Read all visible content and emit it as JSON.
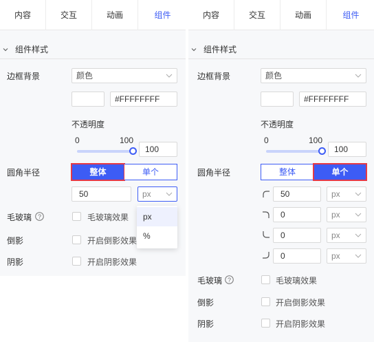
{
  "tabs": [
    "内容",
    "交互",
    "动画",
    "组件"
  ],
  "section_title": "组件样式",
  "border_bg": {
    "label": "边框背景",
    "fill_type": "颜色",
    "color_hex": "#FFFFFFFF",
    "swatch_color": "#ffffff",
    "opacity_label": "不透明度",
    "slider_min": "0",
    "slider_max": "100",
    "opacity_value": "100",
    "opacity_fraction": 1.0
  },
  "radius": {
    "label": "圆角半径",
    "modes": [
      "整体",
      "单个"
    ],
    "overall_value": "50",
    "unit": "px",
    "unit_options": [
      "px",
      "%"
    ],
    "individual": [
      {
        "value": "50",
        "unit": "px"
      },
      {
        "value": "0",
        "unit": "px"
      },
      {
        "value": "0",
        "unit": "px"
      },
      {
        "value": "0",
        "unit": "px"
      }
    ]
  },
  "frosted": {
    "label": "毛玻璃",
    "checkbox_label": "毛玻璃效果"
  },
  "reflection": {
    "label": "倒影",
    "checkbox_label": "开启倒影效果"
  },
  "shadow": {
    "label": "阴影",
    "checkbox_label": "开启阴影效果"
  },
  "colors": {
    "accent": "#3d5cf5",
    "highlight": "#e53945",
    "panel_bg": "#f7f8fa"
  },
  "icons": [
    "chevron-down-icon",
    "help-icon",
    "top-left-corner-icon",
    "top-right-corner-icon",
    "bottom-left-corner-icon",
    "bottom-right-corner-icon"
  ]
}
